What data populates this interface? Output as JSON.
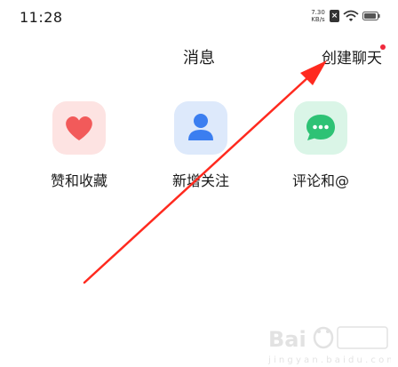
{
  "status_bar": {
    "time": "11:28",
    "net_speed_value": "7.30",
    "net_speed_unit": "KB/s",
    "sim_badge": "×",
    "icons": [
      "sim-off-icon",
      "wifi-icon",
      "battery-icon"
    ]
  },
  "header": {
    "title": "消息",
    "create_chat_label": "创建聊天",
    "create_chat_badge_color": "#f0283c"
  },
  "categories": [
    {
      "label": "赞和收藏",
      "icon": "heart-icon",
      "color": "#f25a5a",
      "bg": "#fde3e2"
    },
    {
      "label": "新增关注",
      "icon": "person-icon",
      "color": "#3b7ef0",
      "bg": "#dde9fb"
    },
    {
      "label": "评论和@",
      "icon": "chat-bubble-icon",
      "color": "#2ec275",
      "bg": "#daf5e7"
    }
  ],
  "annotation": {
    "color": "#ff2a1f",
    "points_to": "create-chat-button"
  },
  "watermark": {
    "text": "Bai百度经验",
    "url_text": "jingyan.baidu.com"
  }
}
